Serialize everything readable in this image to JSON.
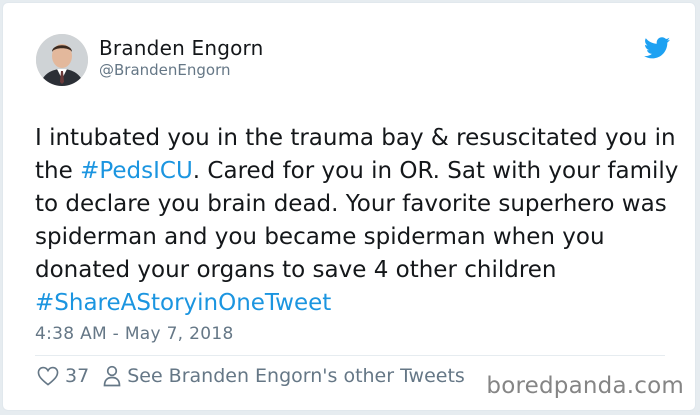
{
  "author": {
    "name": "Branden Engorn",
    "handle": "@BrandenEngorn",
    "avatar_icon": "profile-photo-man-in-suit"
  },
  "platform_icon": "twitter-bird-icon",
  "tweet": {
    "segments": [
      {
        "text": "I intubated you in the trauma bay & resuscitated you in the ",
        "type": "text"
      },
      {
        "text": "#PedsICU",
        "type": "hashtag"
      },
      {
        "text": ". Cared for you in OR. Sat with your family to declare you brain dead. Your favorite superhero was spiderman and you became spiderman when you donated your organs to save 4 other children ",
        "type": "text"
      },
      {
        "text": "#ShareAStoryinOneTweet",
        "type": "hashtag"
      }
    ],
    "timestamp": "4:38 AM - May 7, 2018"
  },
  "actions": {
    "like_icon": "heart-icon",
    "like_count": "37",
    "profile_icon": "person-icon",
    "other_tweets_label": "See Branden Engorn's other Tweets"
  },
  "watermark": "boredpanda.com",
  "colors": {
    "link": "#1b95e0",
    "text": "#14171a",
    "secondary": "#657786",
    "twitter_blue": "#1da1f2"
  }
}
